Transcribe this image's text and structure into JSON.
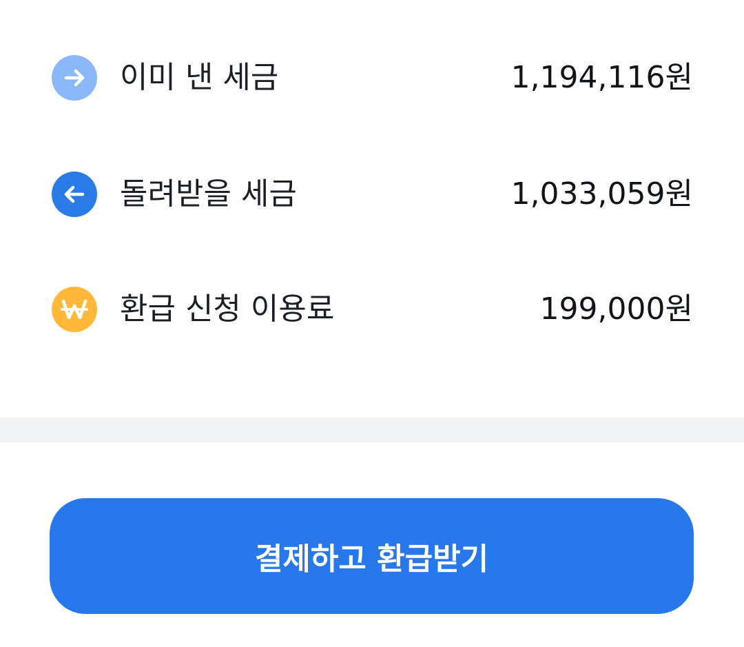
{
  "colors": {
    "paid_icon": "#8bb8fb",
    "refund_icon": "#2a7ae8",
    "fee_icon": "#ffb83a",
    "cta": "#2878ec",
    "divider": "#f2f3f5"
  },
  "summary": {
    "items": [
      {
        "icon": "arrow-right-icon",
        "label": "이미 낸 세금",
        "amount": "1,194,116원"
      },
      {
        "icon": "arrow-left-icon",
        "label": "돌려받을 세금",
        "amount": "1,033,059원"
      },
      {
        "icon": "won-icon",
        "label": "환급 신청 이용료",
        "amount": "199,000원"
      }
    ]
  },
  "cta": {
    "label": "결제하고 환급받기"
  }
}
